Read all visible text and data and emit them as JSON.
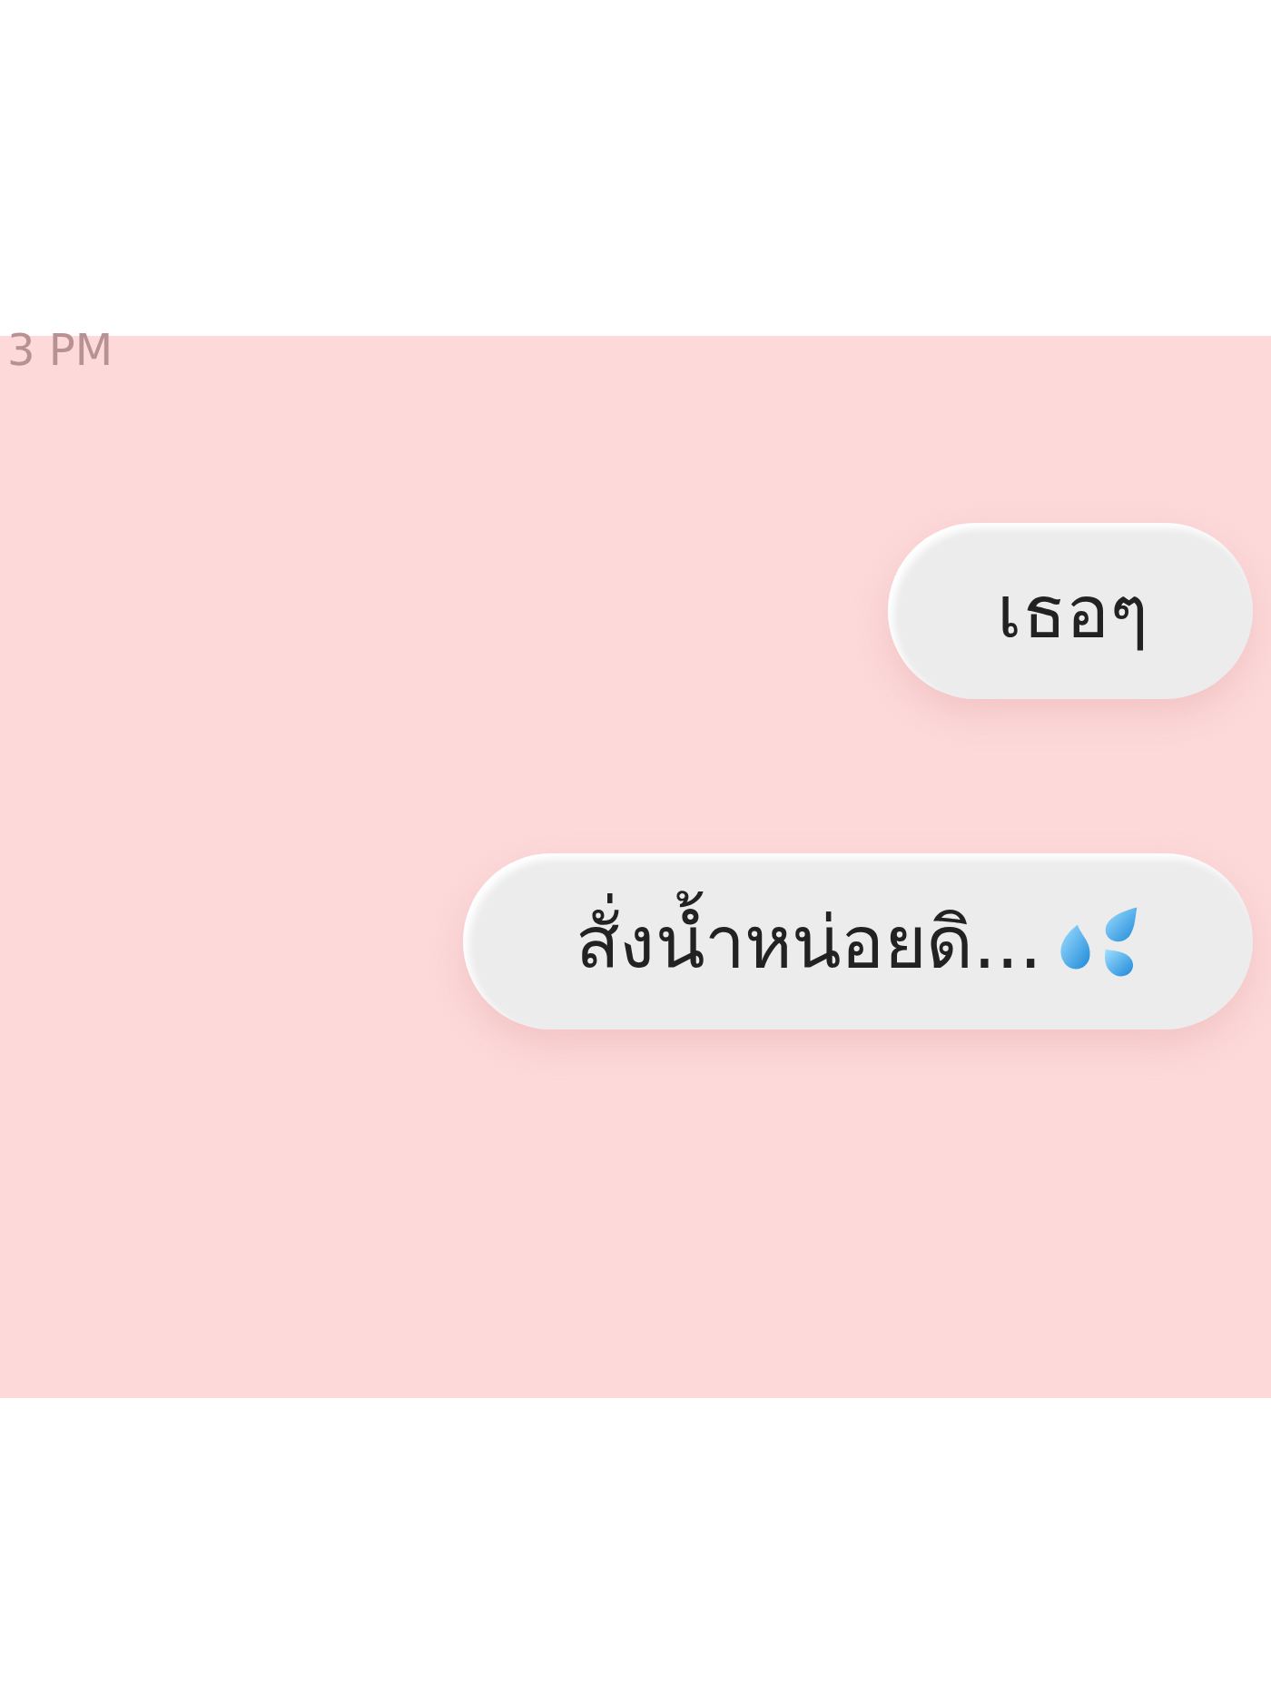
{
  "timestamp": "3 PM",
  "messages": [
    {
      "text": "เธอๆ",
      "emoji": false
    },
    {
      "text": "สั่งน้ำหน่อยดิ...",
      "emoji": true
    }
  ]
}
